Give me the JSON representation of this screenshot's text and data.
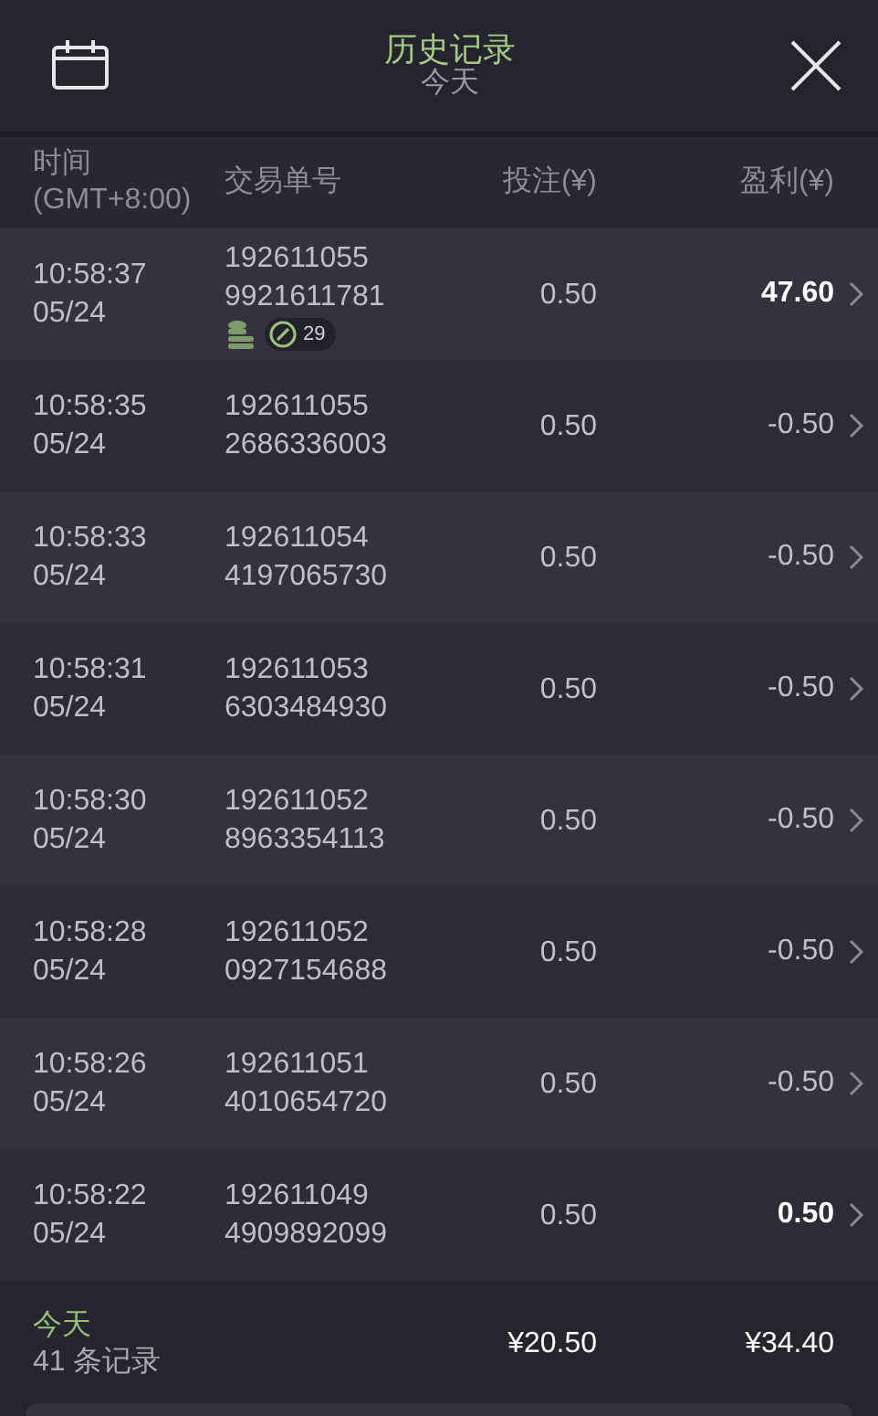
{
  "header": {
    "title": "历史记录",
    "subtitle": "今天"
  },
  "columns": [
    "时间\n(GMT+8:00)",
    "交易单号",
    "投注(¥)",
    "盈利(¥)"
  ],
  "rows": [
    {
      "time": "10:58:37",
      "date": "05/24",
      "order_1": "192611055",
      "order_2": "9921611781",
      "stake": "0.50",
      "profit": "47.60",
      "won": true,
      "badge_count": "29"
    },
    {
      "time": "10:58:35",
      "date": "05/24",
      "order_1": "192611055",
      "order_2": "2686336003",
      "stake": "0.50",
      "profit": "-0.50",
      "won": false
    },
    {
      "time": "10:58:33",
      "date": "05/24",
      "order_1": "192611054",
      "order_2": "4197065730",
      "stake": "0.50",
      "profit": "-0.50",
      "won": false
    },
    {
      "time": "10:58:31",
      "date": "05/24",
      "order_1": "192611053",
      "order_2": "6303484930",
      "stake": "0.50",
      "profit": "-0.50",
      "won": false
    },
    {
      "time": "10:58:30",
      "date": "05/24",
      "order_1": "192611052",
      "order_2": "8963354113",
      "stake": "0.50",
      "profit": "-0.50",
      "won": false
    },
    {
      "time": "10:58:28",
      "date": "05/24",
      "order_1": "192611052",
      "order_2": "0927154688",
      "stake": "0.50",
      "profit": "-0.50",
      "won": false
    },
    {
      "time": "10:58:26",
      "date": "05/24",
      "order_1": "192611051",
      "order_2": "4010654720",
      "stake": "0.50",
      "profit": "-0.50",
      "won": false
    },
    {
      "time": "10:58:22",
      "date": "05/24",
      "order_1": "192611049",
      "order_2": "4909892099",
      "stake": "0.50",
      "profit": "0.50",
      "won": true
    }
  ],
  "footer": {
    "period": "今天",
    "count": "41 条记录",
    "total_stake": "¥20.50",
    "total_profit": "¥34.40"
  }
}
